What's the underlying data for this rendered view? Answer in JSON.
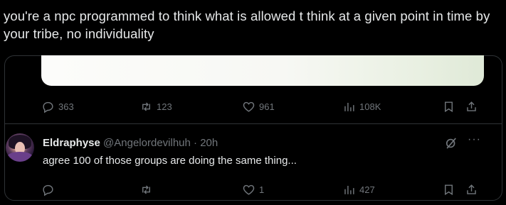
{
  "post": {
    "text": "you're a npc programmed to think what is allowed t think at a given point in time by your tribe, no individuality"
  },
  "quoted_post": {
    "actions": {
      "replies": "363",
      "reposts": "123",
      "likes": "961",
      "views": "108K"
    }
  },
  "reply": {
    "display_name": "Eldraphyse",
    "handle": "@Angelordevilhuh",
    "separator": "·",
    "time": "20h",
    "text": "agree 100 of those groups are doing the same thing...",
    "more_label": "···",
    "actions": {
      "replies": "",
      "reposts": "",
      "likes": "1",
      "views": "427"
    }
  },
  "colors": {
    "background": "#000000",
    "text_primary": "#e7e9ea",
    "text_secondary": "#71767b",
    "border": "#2f3336"
  },
  "icons": {
    "reply": "reply-icon",
    "repost": "repost-icon",
    "like": "heart-icon",
    "views": "views-chart-icon",
    "bookmark": "bookmark-icon",
    "share": "share-icon",
    "grok": "grok-icon",
    "more": "more-icon"
  }
}
